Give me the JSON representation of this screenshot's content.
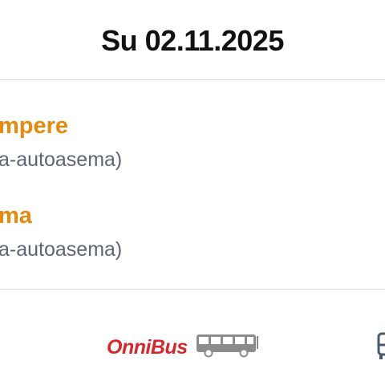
{
  "header": {
    "date": "Su 02.11.2025"
  },
  "route": {
    "departure": {
      "name": "mpere",
      "sub": "a-autoasema)"
    },
    "arrival": {
      "name": "ma",
      "sub": "a-autoasema)"
    }
  },
  "operator": {
    "logo_text": "OnniBus",
    "logo_color": "#d9262b",
    "vehicle_icon": "bus-icon"
  },
  "colors": {
    "accent": "#e58a0c",
    "muted": "#5b6675"
  }
}
